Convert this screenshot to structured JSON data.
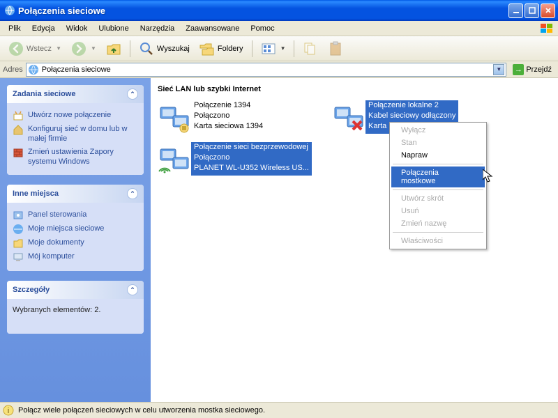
{
  "window": {
    "title": "Połączenia sieciowe"
  },
  "menu": {
    "items": [
      "Plik",
      "Edycja",
      "Widok",
      "Ulubione",
      "Narzędzia",
      "Zaawansowane",
      "Pomoc"
    ]
  },
  "toolbar": {
    "back": "Wstecz",
    "search": "Wyszukaj",
    "folders": "Foldery"
  },
  "addressbar": {
    "label": "Adres",
    "value": "Połączenia sieciowe",
    "go": "Przejdź"
  },
  "sidebar": {
    "tasks": {
      "title": "Zadania sieciowe",
      "items": [
        "Utwórz nowe połączenie",
        "Konfiguruj sieć w domu lub w małej firmie",
        "Zmień ustawienia Zapory systemu Windows"
      ]
    },
    "places": {
      "title": "Inne miejsca",
      "items": [
        "Panel sterowania",
        "Moje miejsca sieciowe",
        "Moje dokumenty",
        "Mój komputer"
      ]
    },
    "details": {
      "title": "Szczegóły",
      "text": "Wybranych elementów: 2."
    }
  },
  "content": {
    "heading": "Sieć LAN lub szybki Internet",
    "connections": [
      {
        "name": "Połączenie 1394",
        "status": "Połączono",
        "device": "Karta sieciowa 1394",
        "selected": false,
        "disconnected": false
      },
      {
        "name": "Połączenie lokalne 2",
        "status": "Kabel sieciowy odłączony",
        "device": "Karta Realtek...",
        "selected": true,
        "disconnected": true
      },
      {
        "name": "Połączenie sieci bezprzewodowej",
        "status": "Połączono",
        "device": "PLANET WL-U352 Wireless US...",
        "selected": true,
        "disconnected": false
      }
    ]
  },
  "contextmenu": {
    "items": [
      {
        "label": "Wyłącz",
        "disabled": true
      },
      {
        "label": "Stan",
        "disabled": true
      },
      {
        "label": "Napraw",
        "disabled": false
      },
      {
        "sep": true
      },
      {
        "label": "Połączenia mostkowe",
        "disabled": false,
        "selected": true
      },
      {
        "sep": true
      },
      {
        "label": "Utwórz skrót",
        "disabled": true
      },
      {
        "label": "Usuń",
        "disabled": true
      },
      {
        "label": "Zmień nazwę",
        "disabled": true
      },
      {
        "sep": true
      },
      {
        "label": "Właściwości",
        "disabled": true
      }
    ]
  },
  "statusbar": {
    "text": "Połącz wiele połączeń sieciowych w celu utworzenia mostka sieciowego."
  }
}
